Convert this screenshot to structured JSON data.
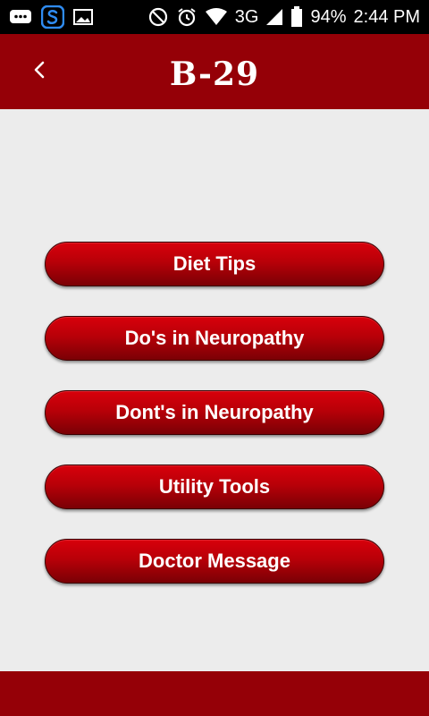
{
  "status_bar": {
    "network": "3G",
    "battery": "94%",
    "time": "2:44 PM",
    "icons": [
      "chat-icon",
      "s-app-icon",
      "image-icon",
      "do-not-disturb-icon",
      "alarm-icon",
      "wifi-icon",
      "signal-icon",
      "battery-icon"
    ]
  },
  "app_bar": {
    "title": "B-29",
    "back_icon": "chevron-left-icon",
    "color": "#950007"
  },
  "menu": {
    "items": [
      {
        "label": "Diet Tips"
      },
      {
        "label": "Do's in Neuropathy"
      },
      {
        "label": "Dont's in Neuropathy"
      },
      {
        "label": "Utility Tools"
      },
      {
        "label": "Doctor Message"
      }
    ]
  },
  "colors": {
    "accent": "#950007",
    "button": "#c00008",
    "background": "#ececec"
  }
}
